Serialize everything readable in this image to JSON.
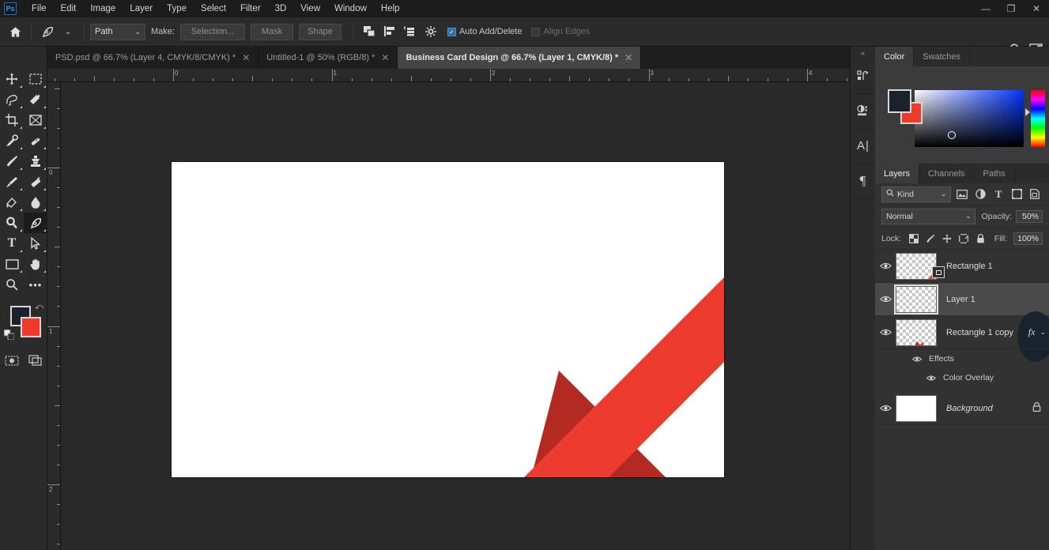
{
  "app": {
    "logo": "Ps"
  },
  "menubar": {
    "items": [
      "File",
      "Edit",
      "Image",
      "Layer",
      "Type",
      "Select",
      "Filter",
      "3D",
      "View",
      "Window",
      "Help"
    ]
  },
  "window_controls": {
    "minimize": "—",
    "restore": "❐",
    "close": "✕"
  },
  "options_bar": {
    "home_icon": "home-icon",
    "tool_icon": "pen-tool-icon",
    "tool_chevron": "⌄",
    "path_mode": {
      "value": "Path",
      "chevron": "⌄"
    },
    "make_label": "Make:",
    "buttons": [
      "Selection...",
      "Mask",
      "Shape"
    ],
    "path_ops_icon": "path-operations-icon",
    "path_align_icon": "path-alignment-icon",
    "path_arrange_icon": "path-arrangement-icon",
    "gear_icon": "gear-icon",
    "auto_add_delete": {
      "label": "Auto Add/Delete",
      "checked": true
    },
    "align_edges": {
      "label": "Align Edges",
      "checked": false
    },
    "search_icon": "search-icon",
    "workspace_icon": "workspace-switcher-icon"
  },
  "tabs": [
    {
      "label": "PSD.psd @ 66.7% (Layer 4, CMYK/8/CMYK) *",
      "active": false,
      "close": "✕"
    },
    {
      "label": "Untitled-1 @ 50% (RGB/8) *",
      "active": false,
      "close": "✕"
    },
    {
      "label": "Business Card Design @ 66.7% (Layer 1, CMYK/8) *",
      "active": true,
      "close": "✕"
    }
  ],
  "toolbar": {
    "tools": [
      {
        "name": "move-tool",
        "glyph": "✥"
      },
      {
        "name": "rectangular-marquee-tool",
        "glyph": "▭"
      },
      {
        "name": "lasso-tool",
        "glyph": "✑"
      },
      {
        "name": "quick-selection-tool",
        "glyph": "✨"
      },
      {
        "name": "crop-tool",
        "glyph": "⌗"
      },
      {
        "name": "frame-tool",
        "glyph": "⊠"
      },
      {
        "name": "eyedropper-tool",
        "glyph": "⚲"
      },
      {
        "name": "spot-healing-brush-tool",
        "glyph": "✚"
      },
      {
        "name": "brush-tool",
        "glyph": "🖌"
      },
      {
        "name": "clone-stamp-tool",
        "glyph": "♟"
      },
      {
        "name": "history-brush-tool",
        "glyph": "✎"
      },
      {
        "name": "eraser-tool",
        "glyph": "◨"
      },
      {
        "name": "gradient-tool",
        "glyph": "◧"
      },
      {
        "name": "blur-tool",
        "glyph": "💧"
      },
      {
        "name": "dodge-tool",
        "glyph": "🔍"
      },
      {
        "name": "pen-tool",
        "glyph": "✒",
        "active": true
      },
      {
        "name": "type-tool",
        "glyph": "T"
      },
      {
        "name": "path-selection-tool",
        "glyph": "➤"
      },
      {
        "name": "rectangle-tool",
        "glyph": "▭"
      },
      {
        "name": "hand-tool",
        "glyph": "✋"
      },
      {
        "name": "zoom-tool",
        "glyph": "🔍"
      },
      {
        "name": "edit-toolbar-button",
        "glyph": "•••"
      }
    ],
    "foreground_color": "#1a222e",
    "background_color": "#f0392b",
    "quick_mask_icon": "quick-mask-icon",
    "screen_mode_icon": "screen-mode-icon"
  },
  "rulers": {
    "unit": "inches",
    "horizontal_labels": [
      "0",
      "1",
      "2",
      "3",
      "4"
    ],
    "vertical_labels": [
      "0",
      "1",
      "2"
    ]
  },
  "canvas": {
    "document": "Business Card Design",
    "zoom": "66.7%",
    "artboard_fill": "#ffffff",
    "stripe_color": "#ee3b30",
    "shadow_color": "#b22a22",
    "workspace_color": "#292929"
  },
  "dock_strip": {
    "collapse_glyph": "«",
    "icons": [
      {
        "name": "history-panel-icon",
        "glyph": "⟲"
      },
      {
        "name": "adjustments-panel-icon",
        "glyph": "◑"
      },
      {
        "name": "character-panel-icon",
        "glyph": "A"
      },
      {
        "name": "paragraph-panel-icon",
        "glyph": "¶"
      }
    ]
  },
  "color_panel": {
    "tabs": [
      {
        "label": "Color",
        "active": true
      },
      {
        "label": "Swatches",
        "active": false
      }
    ],
    "foreground": "#1a222e",
    "background": "#f0392b"
  },
  "layers_panel": {
    "tabs": [
      {
        "label": "Layers",
        "active": true
      },
      {
        "label": "Channels",
        "active": false
      },
      {
        "label": "Paths",
        "active": false
      }
    ],
    "filter": {
      "search_icon": "search-icon",
      "kind_value": "Kind",
      "chevron": "⌄",
      "type_filters": [
        {
          "name": "filter-pixel-layers-icon",
          "glyph": "▤"
        },
        {
          "name": "filter-adjustment-layers-icon",
          "glyph": "◑"
        },
        {
          "name": "filter-type-layers-icon",
          "glyph": "T"
        },
        {
          "name": "filter-shape-layers-icon",
          "glyph": "⛶"
        },
        {
          "name": "filter-smart-objects-icon",
          "glyph": "🖻"
        }
      ]
    },
    "blend_mode": "Normal",
    "opacity_label": "Opacity:",
    "opacity_value": "50%",
    "lock_label": "Lock:",
    "lock_icons": [
      {
        "name": "lock-transparent-pixels-icon",
        "glyph": "▩"
      },
      {
        "name": "lock-image-pixels-icon",
        "glyph": "🖌"
      },
      {
        "name": "lock-position-icon",
        "glyph": "✥"
      },
      {
        "name": "lock-artboard-nesting-icon",
        "glyph": "⛶"
      },
      {
        "name": "lock-all-icon",
        "glyph": "🔒"
      }
    ],
    "fill_label": "Fill:",
    "fill_value": "100%",
    "layers": [
      {
        "name": "Rectangle 1",
        "visible": true,
        "selected": false,
        "thumb": "transparent",
        "has_fx": false,
        "locked": false,
        "italic": false,
        "has_mask": true
      },
      {
        "name": "Layer 1",
        "visible": true,
        "selected": true,
        "thumb": "transparent",
        "has_fx": false,
        "locked": false,
        "italic": false,
        "has_mask": false
      },
      {
        "name": "Rectangle 1 copy",
        "visible": true,
        "selected": false,
        "thumb": "transparent",
        "has_fx": true,
        "locked": false,
        "italic": false,
        "has_mask": false,
        "effects": {
          "label": "Effects",
          "items": [
            {
              "label": "Color Overlay",
              "visible": true
            }
          ],
          "visible": true
        }
      },
      {
        "name": "Background",
        "visible": true,
        "selected": false,
        "thumb": "white",
        "has_fx": false,
        "locked": true,
        "italic": true,
        "has_mask": false
      }
    ]
  }
}
